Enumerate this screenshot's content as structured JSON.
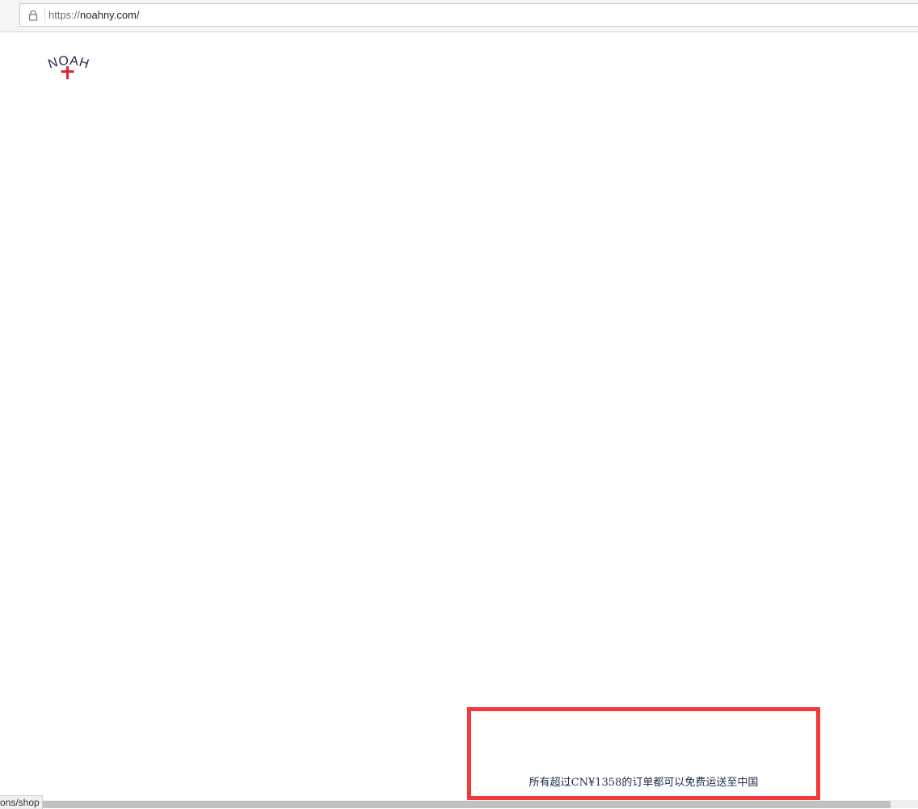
{
  "browser": {
    "url_scheme": "https://",
    "url_host": "noahny.com/",
    "lock_icon": "lock-icon"
  },
  "header": {
    "logo_text": "NOAH",
    "logo_icon": "cross-icon",
    "logo_colors": {
      "text": "#26254a",
      "cross": "#e0262e"
    }
  },
  "promo": {
    "shipping_message": "所有超过CN¥1358的订单都可以免费运送至中国",
    "highlight_color": "#ef3b3b"
  },
  "status_bar": {
    "link_text": "ons/shop"
  }
}
